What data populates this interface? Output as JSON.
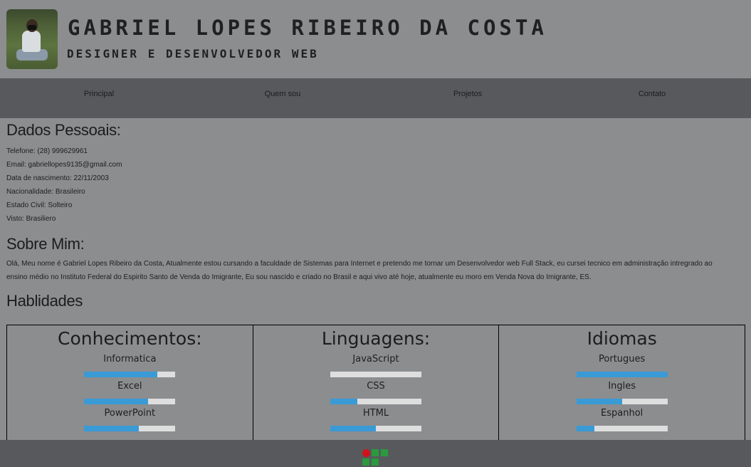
{
  "header": {
    "name": "GABRIEL LOPES RIBEIRO DA COSTA",
    "role": "DESIGNER E DESENVOLVEDOR WEB"
  },
  "nav": {
    "items": [
      {
        "label": "Principal"
      },
      {
        "label": "Quem sou"
      },
      {
        "label": "Projetos"
      },
      {
        "label": "Contato"
      }
    ]
  },
  "personal": {
    "heading": "Dados Pessoais:",
    "lines": [
      "Telefone: (28) 999629961",
      "Email: gabriellopes9135@gmail.com",
      "Data de nascimento: 22/11/2003",
      "Nacionalidade: Brasileiro",
      "Estado Civil: Solteiro",
      "Visto: Brasiliero"
    ]
  },
  "about": {
    "heading": "Sobre Mim:",
    "text": "Olá, Meu nome é Gabriel Lopes Ribeiro da Costa, Atualmente estou cursando a faculdade de Sistemas para Internet e pretendo me tornar um Desenvolvedor web Full Stack, eu cursei tecnico em administração intregrado ao ensino médio no Instituto Federal do Espirito Santo de Venda do Imigrante, Eu sou nascido e criado no Brasil e aqui vivo até hoje, atualmente eu moro em Venda Nova do Imigrante, ES."
  },
  "skills": {
    "heading": "Hablidades",
    "columns": [
      {
        "title": "Conhecimentos:",
        "items": [
          {
            "name": "Informatica",
            "level": 0.8
          },
          {
            "name": "Excel",
            "level": 0.7
          },
          {
            "name": "PowerPoint",
            "level": 0.6
          }
        ]
      },
      {
        "title": "Linguagens:",
        "items": [
          {
            "name": "JavaScript",
            "level": 0.0
          },
          {
            "name": "CSS",
            "level": 0.3
          },
          {
            "name": "HTML",
            "level": 0.5
          }
        ]
      },
      {
        "title": "Idiomas",
        "items": [
          {
            "name": "Portugues",
            "level": 1.0
          },
          {
            "name": "Ingles",
            "level": 0.5
          },
          {
            "name": "Espanhol",
            "level": 0.2
          }
        ]
      }
    ]
  },
  "footer": {
    "logo_icon": "if-logo-icon",
    "logo_colors": {
      "dot": "#d0121b",
      "squares": "#2b9a3e"
    }
  },
  "colors": {
    "page_bg": "#8c8d8f",
    "nav_bg": "#57595c",
    "bar_fill": "#3a9ad6",
    "bar_track": "#dedede"
  }
}
